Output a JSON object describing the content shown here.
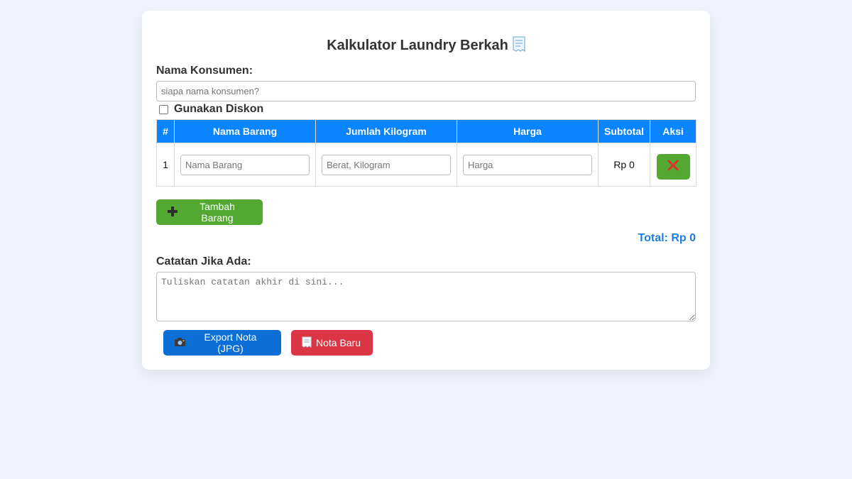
{
  "header": {
    "title": "Kalkulator Laundry Berkah"
  },
  "customer": {
    "label": "Nama Konsumen:",
    "value": "",
    "placeholder": "siapa nama konsumen?"
  },
  "discount": {
    "label": "Gunakan Diskon",
    "checked": false
  },
  "table": {
    "headers": {
      "no": "#",
      "item": "Nama Barang",
      "weight": "Jumlah Kilogram",
      "price": "Harga",
      "subtotal": "Subtotal",
      "action": "Aksi"
    },
    "rows": [
      {
        "no": "1",
        "item_value": "",
        "item_placeholder": "Nama Barang",
        "weight_value": "",
        "weight_placeholder": "Berat, Kilogram",
        "price_value": "",
        "price_placeholder": "Harga",
        "subtotal": "Rp 0"
      }
    ]
  },
  "actions": {
    "add_label": "Tambah Barang",
    "export_label": "Export Nota (JPG)",
    "new_label": "Nota Baru"
  },
  "total": {
    "text": "Total: Rp 0"
  },
  "notes": {
    "label": "Catatan Jika Ada:",
    "value": "",
    "placeholder": "Tuliskan catatan akhir di sini..."
  },
  "icons": {
    "title": "receipt-icon",
    "delete": "cross-mark-icon",
    "add": "plus-icon",
    "export": "camera-icon",
    "new": "receipt-icon"
  },
  "colors": {
    "background": "#f0f3fd",
    "header_blue": "#0a84ff",
    "green": "#53a832",
    "export_blue": "#0b6fd6",
    "red": "#dc3545",
    "total_blue": "#1c7fde"
  }
}
